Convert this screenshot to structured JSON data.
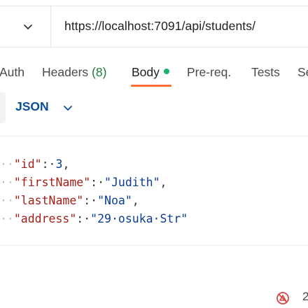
{
  "request": {
    "url": "https://localhost:7091/api/students/"
  },
  "tabs": {
    "auth": "Auth",
    "headers": "Headers",
    "headers_count": "(8)",
    "body": "Body",
    "prereq": "Pre-req.",
    "tests": "Tests",
    "settings_partial": "Se"
  },
  "body_editor": {
    "mode": "JSON",
    "lines": [
      {
        "ws": "··",
        "key": "\"id\"",
        "sep": ":·",
        "value": "3",
        "value_type": "num",
        "tail": ","
      },
      {
        "ws": "··",
        "key": "\"firstName\"",
        "sep": ":·",
        "value": "\"Judith\"",
        "value_type": "str",
        "tail": ","
      },
      {
        "ws": "··",
        "key": "\"lastName\"",
        "sep": ":·",
        "value": "\"Noa\"",
        "value_type": "str",
        "tail": ","
      },
      {
        "ws": "··",
        "key": "\"address\"",
        "sep": ":·",
        "value": "\"29·osuka·Str\"",
        "value_type": "str",
        "tail": ""
      }
    ]
  },
  "status": {
    "icon": "bug-icon",
    "count": "2"
  },
  "colors": {
    "accent": "#ff6c37",
    "active_dot": "#1bb36b",
    "json_keyword": "#0b4f9c",
    "json_key": "#a3201b",
    "json_value": "#0b3d91",
    "status_icon": "#d64545"
  }
}
